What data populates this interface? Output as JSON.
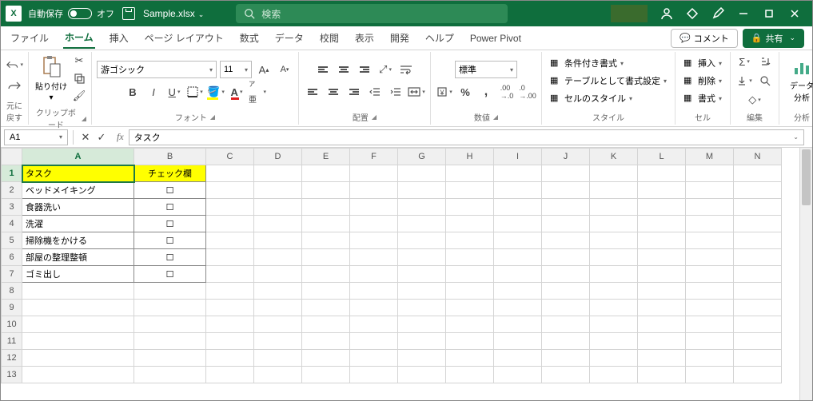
{
  "title": {
    "autosave_label": "自動保存",
    "autosave_state": "オフ",
    "filename": "Sample.xlsx",
    "search_placeholder": "検索"
  },
  "tabs": {
    "file": "ファイル",
    "home": "ホーム",
    "insert": "挿入",
    "layout": "ページ レイアウト",
    "formulas": "数式",
    "data": "データ",
    "review": "校閲",
    "view": "表示",
    "dev": "開発",
    "help": "ヘルプ",
    "pp": "Power Pivot",
    "comment": "コメント",
    "share": "共有"
  },
  "ribbon": {
    "undo": "元に戻す",
    "clipboard": "クリップボード",
    "paste": "貼り付け",
    "font_grp": "フォント",
    "align_grp": "配置",
    "num_grp": "数値",
    "style_grp": "スタイル",
    "cell_grp": "セル",
    "edit_grp": "編集",
    "analysis_grp": "分析",
    "font_name": "游ゴシック",
    "font_size": "11",
    "num_format": "標準",
    "cond": "条件付き書式",
    "tablefmt": "テーブルとして書式設定",
    "cellstyle": "セルのスタイル",
    "ins": "挿入",
    "del": "削除",
    "fmt": "書式",
    "analysis_btn": "データ\n分析"
  },
  "nb": {
    "ref": "A1",
    "formula": "タスク"
  },
  "cols": [
    "A",
    "B",
    "C",
    "D",
    "E",
    "F",
    "G",
    "H",
    "I",
    "J",
    "K",
    "L",
    "M",
    "N"
  ],
  "rows": [
    "1",
    "2",
    "3",
    "4",
    "5",
    "6",
    "7",
    "8",
    "9",
    "10",
    "11",
    "12",
    "13"
  ],
  "data": {
    "headers": [
      "タスク",
      "チェック欄"
    ],
    "tasks": [
      "ベッドメイキング",
      "食器洗い",
      "洗濯",
      "掃除機をかける",
      "部屋の整理整頓",
      "ゴミ出し"
    ],
    "check": "☐"
  }
}
